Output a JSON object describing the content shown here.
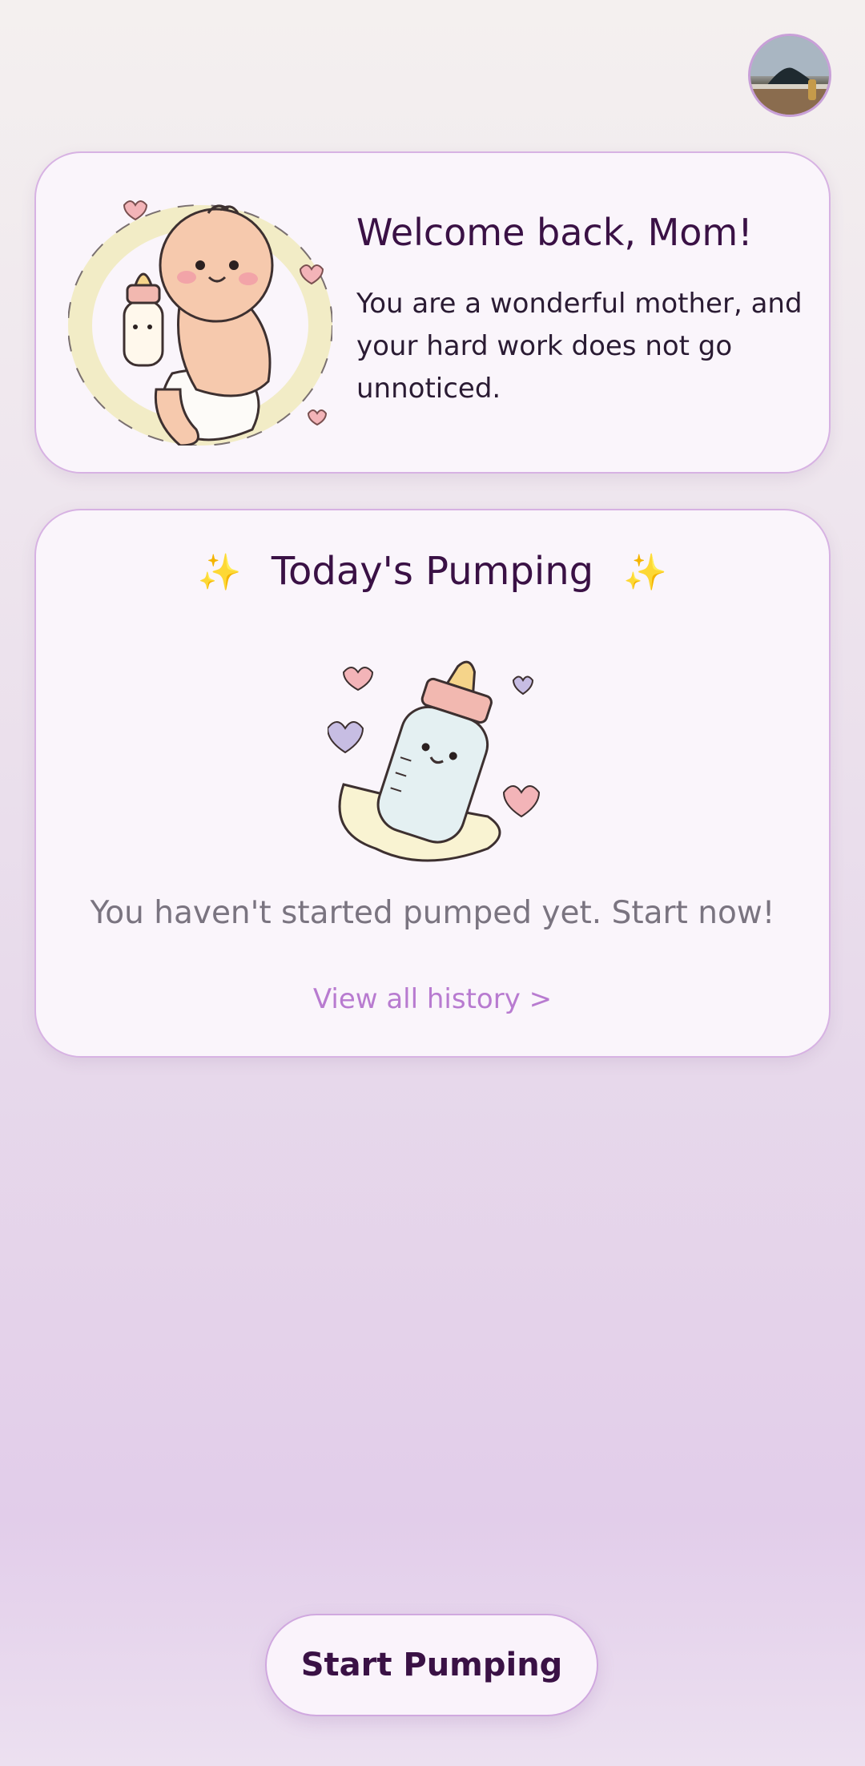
{
  "profile": {
    "avatar_icon": "profile-photo-icon"
  },
  "welcome": {
    "title": "Welcome back, Mom!",
    "message": "You are a wonderful mother, and your hard work does not go unnoticed.",
    "illustration": "baby-with-bottle-illustration"
  },
  "pumping": {
    "header_title": "Today's Pumping",
    "sparkle_left": "✨",
    "sparkle_right": "✨",
    "illustration": "baby-bottle-illustration",
    "status_text": "You haven't started pumped yet. Start now!",
    "history_link": "View all history >"
  },
  "actions": {
    "start_label": "Start Pumping"
  },
  "colors": {
    "accent": "#b87bd0",
    "title": "#3a1145",
    "card_border": "#d7b2e3",
    "card_bg": "#faf5fb"
  }
}
